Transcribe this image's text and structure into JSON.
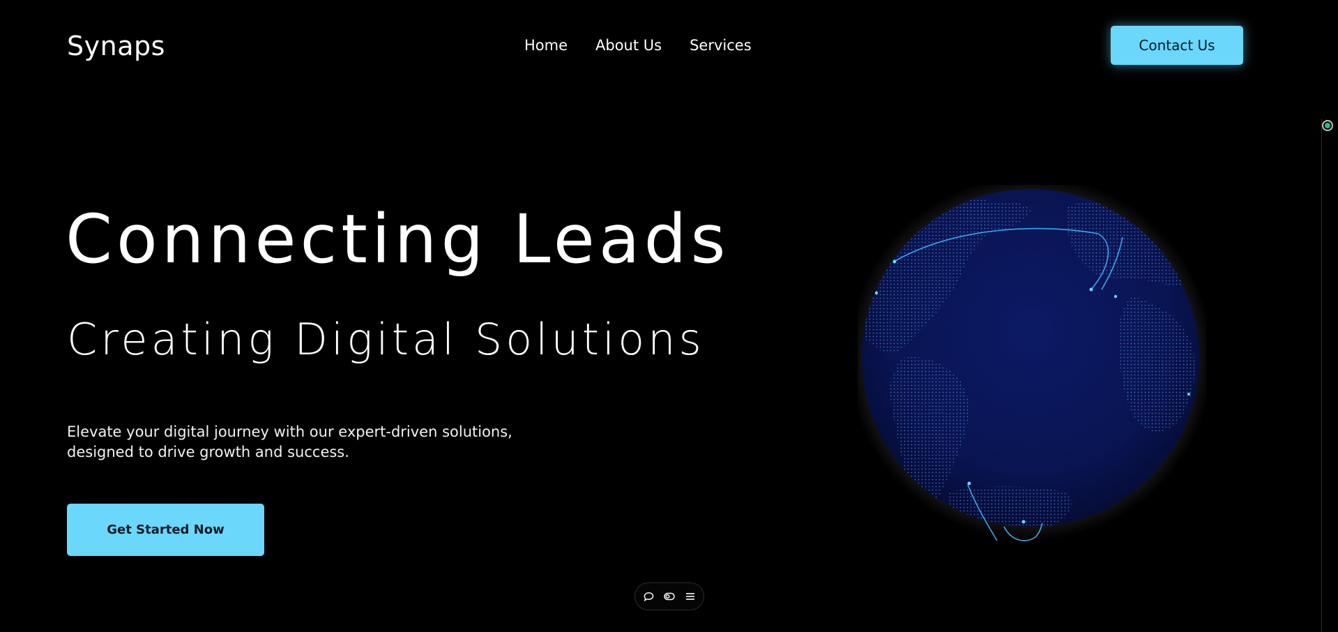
{
  "header": {
    "logo": "Synaps",
    "nav": [
      "Home",
      "About Us",
      "Services"
    ],
    "contact_label": "Contact Us"
  },
  "hero": {
    "title": "Connecting Leads",
    "subtitle": "Creating Digital Solutions",
    "description_line1": "Elevate your digital journey with our expert-driven solutions,",
    "description_line2": "designed to drive growth and success.",
    "cta_label": "Get Started Now"
  },
  "toolbar": {
    "icons": [
      "chat-icon",
      "toggle-icon",
      "menu-icon"
    ]
  },
  "colors": {
    "background": "#000000",
    "accent": "#6ad7fb",
    "globe": "#0a1554",
    "globe_dots": "#4a78c8",
    "arc": "#3aa8f0",
    "scroll_indicator": "#1cc08a"
  }
}
